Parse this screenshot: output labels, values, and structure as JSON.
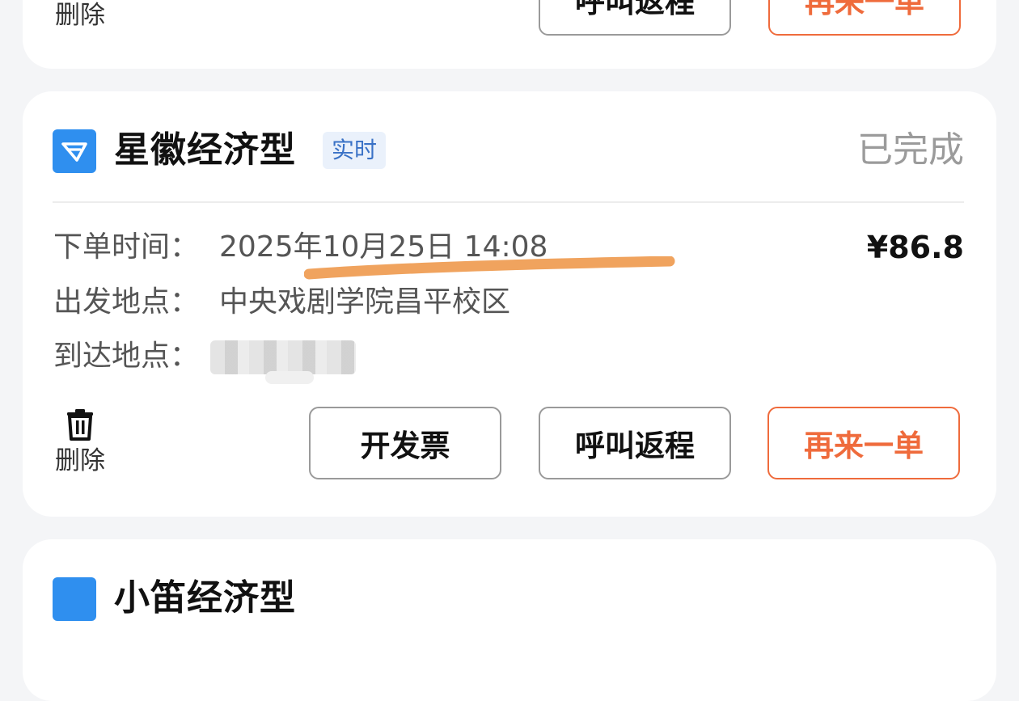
{
  "colors": {
    "page_bg": "#f4f5f7",
    "card_bg": "#ffffff",
    "brand_blue": "#2f8fef",
    "tag_bg": "#eaf1fb",
    "tag_text": "#3a72c6",
    "status_gray": "#9b9b9b",
    "accent_orange": "#ef6b3c",
    "highlight_mark": "#f0a35e"
  },
  "top_card": {
    "delete_label": "删除",
    "return_label": "呼叫返程",
    "again_label": "再来一单"
  },
  "order": {
    "service_name": "星徽经济型",
    "mode_tag": "实时",
    "status": "已完成",
    "time_label": "下单时间：",
    "time_value": "2025年10月25日 14:08",
    "price": "¥86.8",
    "from_label": "出发地点：",
    "from_value": "中央戏剧学院昌平校区",
    "to_label": "到达地点：",
    "delete_label": "删除",
    "invoice_label": "开发票",
    "return_label": "呼叫返程",
    "again_label": "再来一单",
    "icons": {
      "brand": "app-logo-icon",
      "delete": "trash-icon"
    }
  },
  "bottom_card": {
    "service_name": "小笛经济型"
  }
}
